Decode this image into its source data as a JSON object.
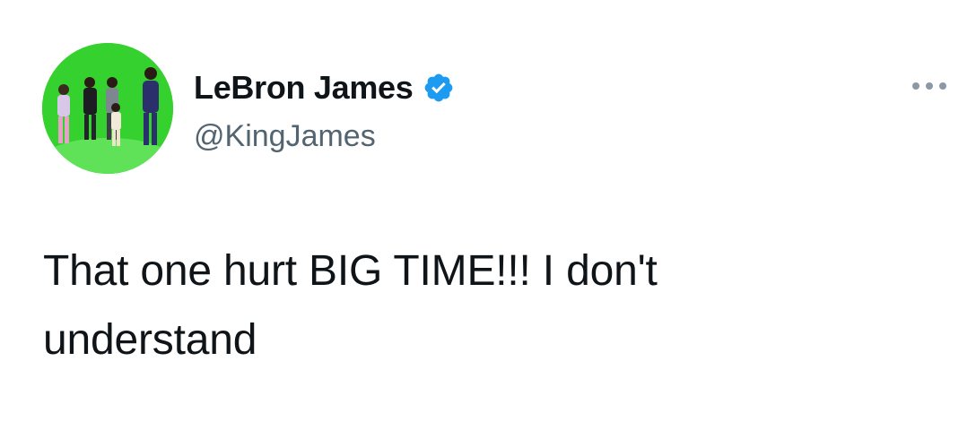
{
  "tweet": {
    "author": {
      "display_name": "LeBron James",
      "handle": "@KingJames",
      "verified": true,
      "avatar_icon": "profile-photo"
    },
    "more_icon": "more-options-icon",
    "text_line1": "That one hurt BIG TIME!!! I don't",
    "text_line2": "understand"
  },
  "colors": {
    "verified_badge": "#1d9bf0",
    "handle_gray": "#536471",
    "text": "#0f1419",
    "avatar_background": "#2fcc2a"
  }
}
